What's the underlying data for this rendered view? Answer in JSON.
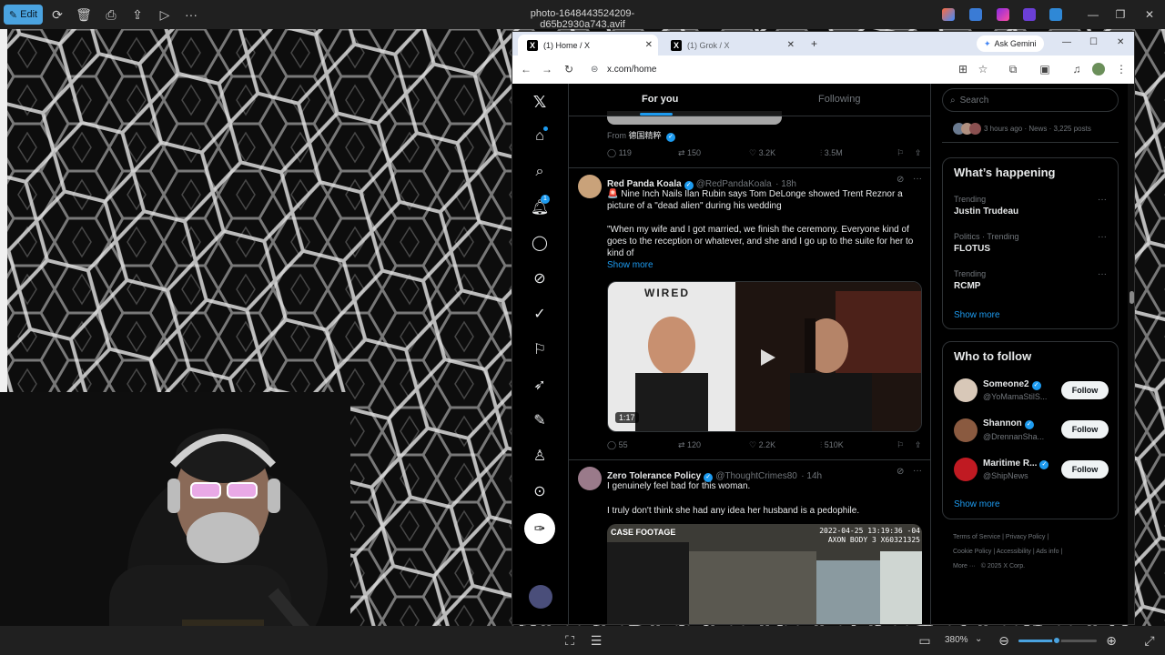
{
  "photos_app": {
    "edit_label": "Edit",
    "file_title": "photo-1648443524209-d65b2930a743.avif",
    "zoom_level": "380%"
  },
  "browser": {
    "tabs": [
      {
        "label": "(1) Home / X",
        "active": true
      },
      {
        "label": "(1) Grok / X",
        "active": false
      }
    ],
    "ask_gemini": "Ask Gemini",
    "url": "x.com/home"
  },
  "x": {
    "feed_tabs": [
      "For you",
      "Following"
    ],
    "search_placeholder": "Search",
    "prev_tweet": {
      "from_label": "From",
      "from_source": "德国精粹",
      "replies": "119",
      "reposts": "150",
      "likes": "3.2K",
      "views": "3.5M"
    },
    "tweet1": {
      "name": "Red Panda Koala",
      "handle": "@RedPandaKoala",
      "time": "· 18h",
      "line1": "🚨 Nine Inch Nails Ilan Rubin says Tom DeLonge showed Trent Reznor a",
      "line2": "picture of a \"dead alien\" during his wedding",
      "line3": "\"When my wife and I got married, we finish the ceremony. Everyone kind of",
      "line4": "goes to the reception or whatever, and she and I go up to the suite for her to",
      "line5": "kind of",
      "show_more": "Show more",
      "video_duration": "1:17",
      "media_text": "WIRED",
      "replies": "55",
      "reposts": "120",
      "likes": "2.2K",
      "views": "510K"
    },
    "tweet2": {
      "name": "Zero Tolerance Policy",
      "handle": "@ThoughtCrimes80",
      "time": "· 14h",
      "line1": "I genuinely feel bad for this woman.",
      "line2": "I truly don't think she had any idea her husband is a pedophile.",
      "overlay_left": "CASE FOOTAGE",
      "overlay_right1": "2022-04-25 13:19:36 -04",
      "overlay_right2": "AXON BODY 3 X60321325"
    },
    "news_item": "3 hours ago · News · 3,225 posts",
    "whats_happening": {
      "title": "What’s happening",
      "trends": [
        {
          "meta": "Trending",
          "name": "Justin Trudeau"
        },
        {
          "meta": "Politics · Trending",
          "name": "FLOTUS"
        },
        {
          "meta": "Trending",
          "name": "RCMP"
        }
      ],
      "show_more": "Show more"
    },
    "who_to_follow": {
      "title": "Who to follow",
      "accounts": [
        {
          "name": "Someone2",
          "handle": "@YoMamaStilS...",
          "button": "Follow"
        },
        {
          "name": "Shannon",
          "handle": "@DrennanSha...",
          "button": "Follow"
        },
        {
          "name": "Maritime R...",
          "handle": "@ShipNews",
          "button": "Follow"
        }
      ],
      "show_more": "Show more"
    },
    "footer": {
      "l1": "Terms of Service",
      "l2": "Privacy Policy",
      "l3": "Cookie Policy",
      "l4": "Accessibility",
      "l5": "Ads info",
      "l6": "More ···",
      "l7": "© 2025 X Corp."
    },
    "notification_badge": "1"
  },
  "colors": {
    "accent": "#1d9bf0",
    "edit_button": "#4aa3e0",
    "x_background": "#000000"
  }
}
